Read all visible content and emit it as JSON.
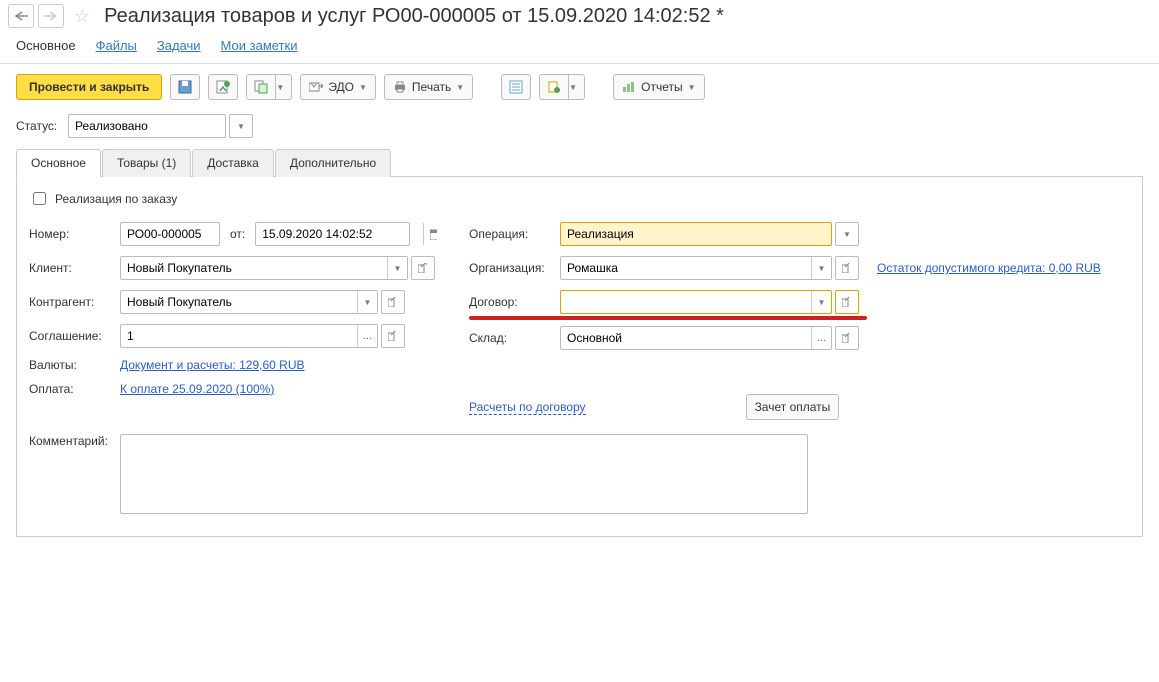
{
  "header": {
    "title": "Реализация товаров и услуг РО00-000005 от 15.09.2020 14:02:52 *"
  },
  "nav": {
    "main": "Основное",
    "files": "Файлы",
    "tasks": "Задачи",
    "notes": "Мои заметки"
  },
  "toolbar": {
    "post_close": "Провести и закрыть",
    "edo": "ЭДО",
    "print": "Печать",
    "reports": "Отчеты"
  },
  "status": {
    "label": "Статус:",
    "value": "Реализовано"
  },
  "tabs": {
    "main": "Основное",
    "goods": "Товары (1)",
    "delivery": "Доставка",
    "extra": "Дополнительно"
  },
  "form": {
    "by_order_label": "Реализация по заказу",
    "number_label": "Номер:",
    "number_value": "РО00-000005",
    "from_label": "от:",
    "date_value": "15.09.2020 14:02:52",
    "client_label": "Клиент:",
    "client_value": "Новый Покупатель",
    "counterparty_label": "Контрагент:",
    "counterparty_value": "Новый Покупатель",
    "agreement_label": "Соглашение:",
    "agreement_value": "1",
    "currency_label": "Валюты:",
    "currency_link": "Документ и расчеты: 129,60 RUB",
    "payment_label": "Оплата:",
    "payment_link": "К оплате 25.09.2020 (100%)",
    "comment_label": "Комментарий:",
    "operation_label": "Операция:",
    "operation_value": "Реализация",
    "org_label": "Организация:",
    "org_value": "Ромашка",
    "contract_label": "Договор:",
    "contract_value": "",
    "warehouse_label": "Склад:",
    "warehouse_value": "Основной",
    "credit_link": "Остаток допустимого кредита: 0,00 RUB",
    "contract_calc_link": "Расчеты по договору",
    "offset_btn": "Зачет оплаты"
  }
}
